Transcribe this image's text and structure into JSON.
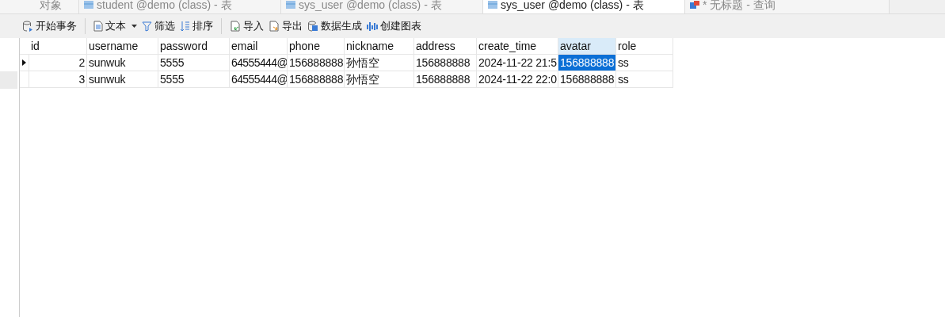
{
  "tabs": [
    {
      "label": "对象",
      "kind": "objects",
      "selected": false
    },
    {
      "label": "student @demo (class) - 表",
      "kind": "table",
      "selected": false
    },
    {
      "label": "sys_user @demo (class) - 表",
      "kind": "table",
      "selected": false
    },
    {
      "label": "sys_user @demo (class) - 表",
      "kind": "table",
      "selected": true
    },
    {
      "label": "* 无标题 - 查询",
      "kind": "query",
      "selected": false
    }
  ],
  "toolbar": [
    {
      "label": "开始事务",
      "kind": "transaction"
    },
    {
      "kind": "separator"
    },
    {
      "label": "文本",
      "kind": "text"
    },
    {
      "label": "筛选",
      "kind": "filter"
    },
    {
      "label": "排序",
      "kind": "sort"
    },
    {
      "kind": "separator"
    },
    {
      "label": "导入",
      "kind": "import"
    },
    {
      "label": "导出",
      "kind": "export"
    },
    {
      "label": "数据生成",
      "kind": "generate"
    },
    {
      "label": "创建图表",
      "kind": "chart"
    }
  ],
  "table": {
    "columns": [
      {
        "label": "id",
        "selected": false
      },
      {
        "label": "username",
        "selected": false
      },
      {
        "label": "password",
        "selected": false
      },
      {
        "label": "email",
        "selected": false
      },
      {
        "label": "phone",
        "selected": false
      },
      {
        "label": "nickname",
        "selected": false
      },
      {
        "label": "address",
        "selected": false
      },
      {
        "label": "create_time",
        "selected": false
      },
      {
        "label": "avatar",
        "selected": true
      },
      {
        "label": "role",
        "selected": false
      }
    ],
    "rows": [
      {
        "current": true,
        "cells": [
          {
            "text": "2",
            "selected": false
          },
          {
            "text": "sunwuk",
            "selected": false
          },
          {
            "text": "5555",
            "selected": false
          },
          {
            "text": "64555444@",
            "selected": false
          },
          {
            "text": "156888888",
            "selected": false
          },
          {
            "text": "孙悟空",
            "selected": false
          },
          {
            "text": "156888888",
            "selected": false
          },
          {
            "text": "2024-11-22 21:5",
            "selected": false
          },
          {
            "text": "156888888",
            "selected": true
          },
          {
            "text": "ss",
            "selected": false
          }
        ]
      },
      {
        "current": false,
        "cells": [
          {
            "text": "3",
            "selected": false
          },
          {
            "text": "sunwuk",
            "selected": false
          },
          {
            "text": "5555",
            "selected": false
          },
          {
            "text": "64555444@",
            "selected": false
          },
          {
            "text": "156888888",
            "selected": false
          },
          {
            "text": "孙悟空",
            "selected": false
          },
          {
            "text": "156888888",
            "selected": false
          },
          {
            "text": "2024-11-22 22:0",
            "selected": false
          },
          {
            "text": "156888888",
            "selected": false
          },
          {
            "text": "ss",
            "selected": false
          }
        ]
      }
    ]
  }
}
